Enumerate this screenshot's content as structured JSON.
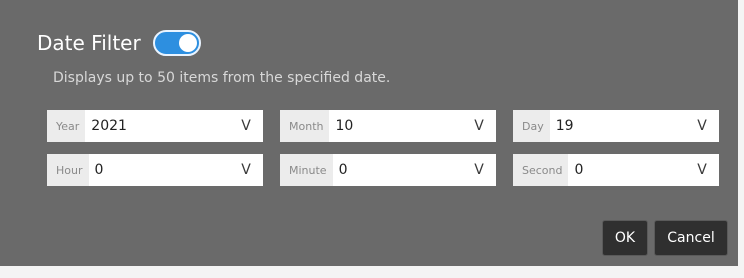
{
  "dialog": {
    "title": "Date Filter",
    "toggle_on": true,
    "subtitle": "Displays up to 50 items from the specified date."
  },
  "fields": {
    "year": {
      "label": "Year",
      "value": "2021"
    },
    "month": {
      "label": "Month",
      "value": "10"
    },
    "day": {
      "label": "Day",
      "value": "19"
    },
    "hour": {
      "label": "Hour",
      "value": "0"
    },
    "minute": {
      "label": "Minute",
      "value": "0"
    },
    "second": {
      "label": "Second",
      "value": "0"
    },
    "chevron": "V"
  },
  "buttons": {
    "ok": "OK",
    "cancel": "Cancel"
  },
  "colors": {
    "dialog_bg": "#6a6a6a",
    "toggle_accent": "#2d8fe0",
    "button_bg": "#2f2f2f"
  }
}
